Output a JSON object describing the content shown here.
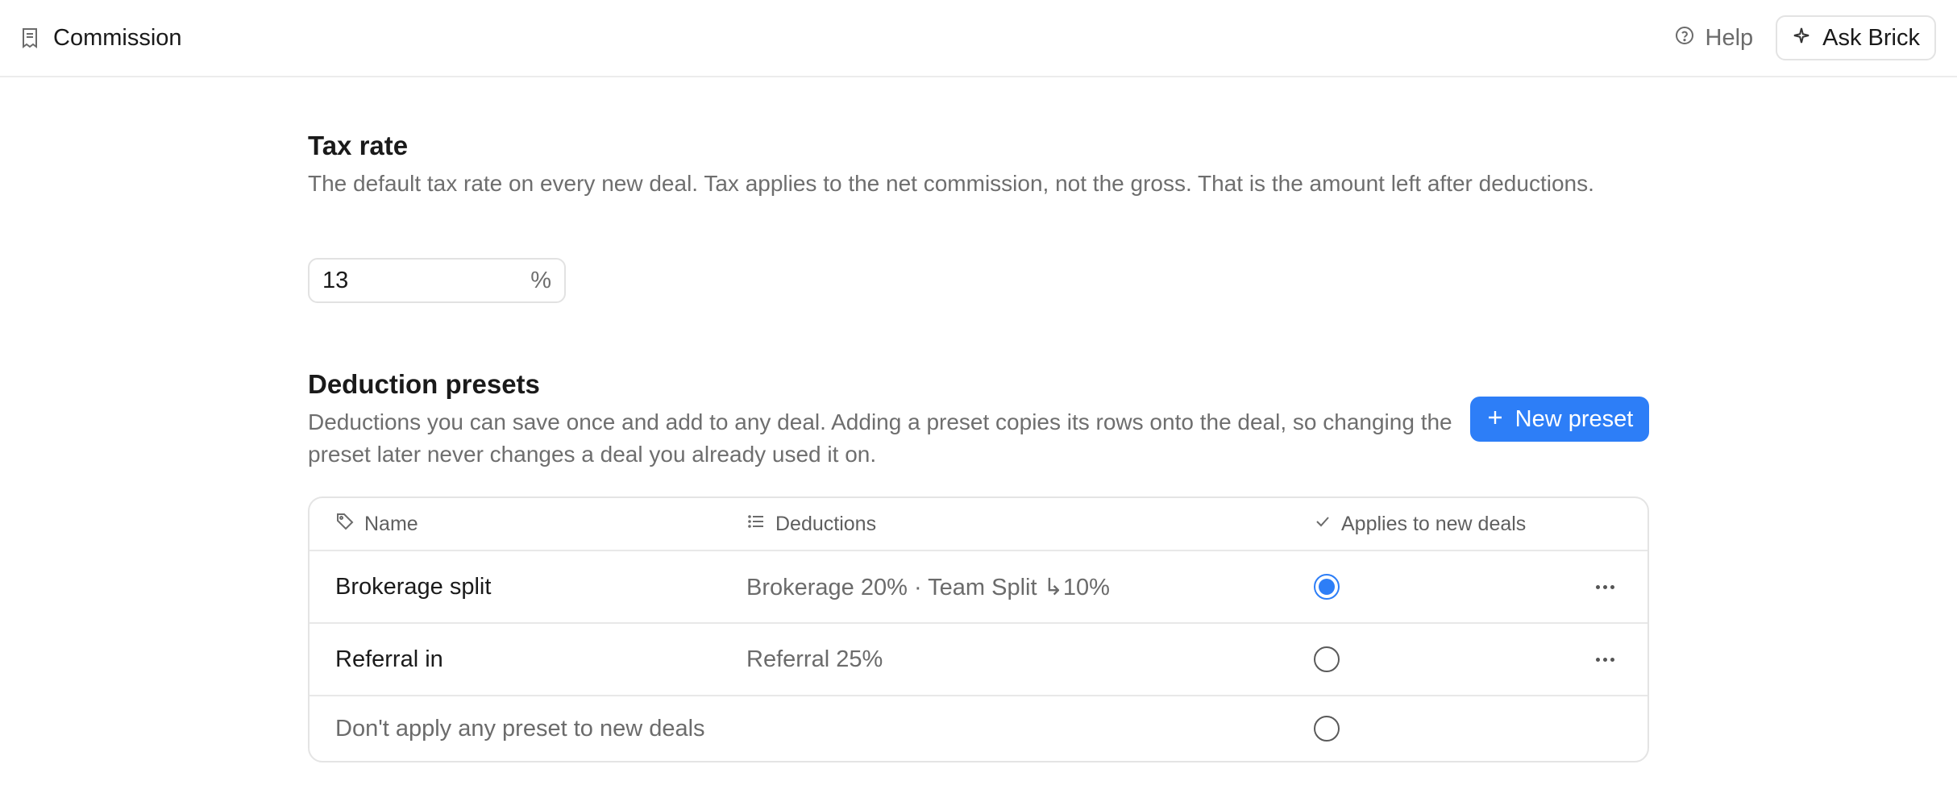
{
  "header": {
    "title": "Commission",
    "help_label": "Help",
    "ask_label": "Ask Brick"
  },
  "tax": {
    "title": "Tax rate",
    "description": "The default tax rate on every new deal. Tax applies to the net commission, not the gross. That is the amount left after deductions.",
    "value": "13",
    "suffix": "%"
  },
  "deductions": {
    "title": "Deduction presets",
    "description": "Deductions you can save once and add to any deal. Adding a preset copies its rows onto the deal, so changing the preset later never changes a deal you already used it on.",
    "new_button_label": "New preset",
    "columns": {
      "name": "Name",
      "deductions": "Deductions",
      "applies": "Applies to new deals"
    },
    "rows": [
      {
        "name": "Brokerage split",
        "deductions": "Brokerage 20% · Team Split ↳10%",
        "selected": true
      },
      {
        "name": "Referral in",
        "deductions": "Referral 25%",
        "selected": false
      }
    ],
    "none_option": {
      "label": "Don't apply any preset to new deals",
      "selected": false
    }
  },
  "colors": {
    "accent": "#2d7ef7",
    "text": "#1a1a1a",
    "muted": "#6e6e6e",
    "border": "#e4e4e4"
  },
  "icons": [
    "document-icon",
    "help-circle-icon",
    "sparkle-icon",
    "plus-icon",
    "tag-icon",
    "list-icon",
    "check-icon",
    "more-horizontal-icon"
  ]
}
